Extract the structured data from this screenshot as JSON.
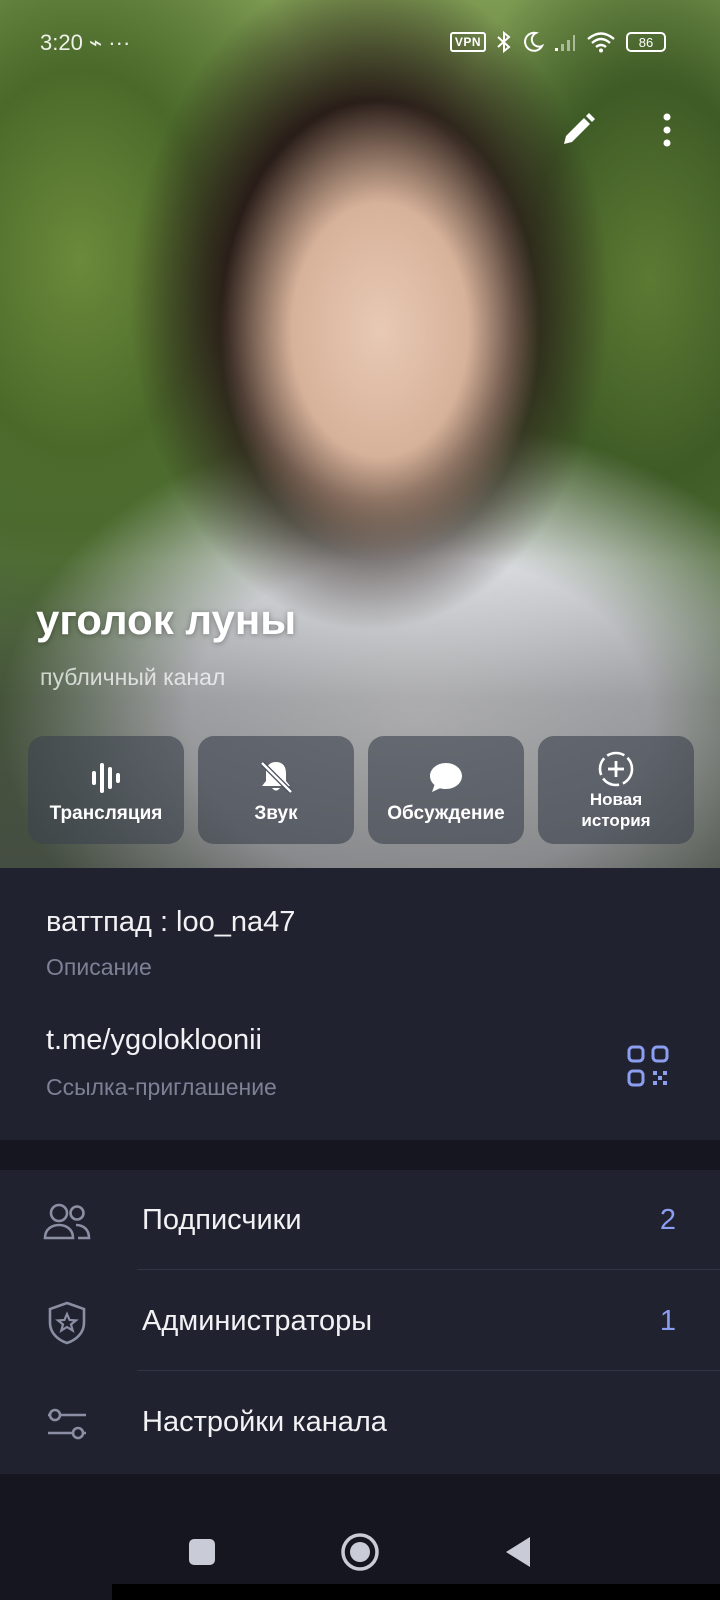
{
  "status_bar": {
    "time": "3:20 ⌁ ···",
    "vpn": "VPN",
    "battery": "86"
  },
  "header": {
    "title": "уголок луны",
    "subtitle": "публичный канал"
  },
  "actions": [
    {
      "label": "Трансляция",
      "icon": "live-stream-icon"
    },
    {
      "label": "Звук",
      "icon": "bell-off-icon"
    },
    {
      "label": "Обсуждение",
      "icon": "chat-bubble-icon"
    },
    {
      "label": "Новая история",
      "label_line1": "Новая",
      "label_line2": "история",
      "icon": "add-story-icon"
    }
  ],
  "info": {
    "description_value": "ваттпад : loo_na47",
    "description_label": "Описание",
    "link_value": "t.me/ygolokloonii",
    "link_label": "Ссылка-приглашение"
  },
  "menu": {
    "items": [
      {
        "label": "Подписчики",
        "count": "2",
        "icon": "subscribers-icon"
      },
      {
        "label": "Администраторы",
        "count": "1",
        "icon": "admin-shield-icon"
      },
      {
        "label": "Настройки канала",
        "count": "",
        "icon": "settings-sliders-icon"
      }
    ]
  },
  "colors": {
    "accent": "#8c9ef0",
    "background": "#21222f",
    "secondary_text": "#7d8195"
  }
}
